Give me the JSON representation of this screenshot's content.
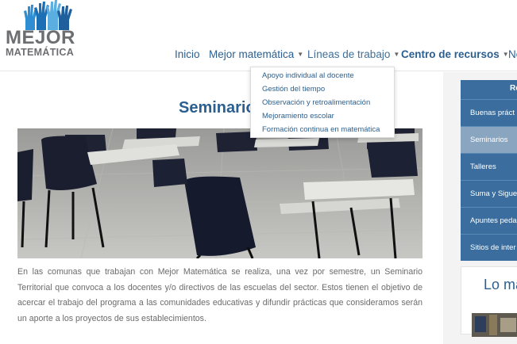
{
  "logo": {
    "word1": "MEJOR",
    "word2": "MATEMÁTICA",
    "icon": "raised-hands-logo",
    "colors": {
      "text": "#6d6e71",
      "hands": [
        "#1a6fb5",
        "#2f8ed1",
        "#5aaee0",
        "#1f5f9c"
      ]
    }
  },
  "nav": {
    "items": [
      {
        "label": "Inicio",
        "caret": ""
      },
      {
        "label": "Mejor matemática",
        "caret": "▼"
      },
      {
        "label": "Líneas de trabajo",
        "caret": "▼"
      },
      {
        "label": "Centro de recursos",
        "caret": "▼"
      },
      {
        "label": "No",
        "caret": ""
      }
    ],
    "color": "#2b5f8f"
  },
  "dropdown": {
    "items": [
      "Apoyo individual al docente",
      "Gestión del tiempo",
      "Observación y retroalimentación",
      "Mejoramiento escolar",
      "Formación continua en matemática"
    ]
  },
  "main": {
    "title": "Seminario",
    "image": "classroom-chairs-photo",
    "paragraph": "En las comunas que trabajan con Mejor Matemática se realiza, una vez por semestre, un Seminario Territorial que convoca a los docentes y/o directivos de las escuelas del sector. Estos tienen el objetivo de acercar el trabajo del programa a las comunidades educativas y difundir prácticas que consideramos serán un aporte a los proyectos de sus establecimientos."
  },
  "sidebar": {
    "header": "Re",
    "items": [
      {
        "label": "Buenas práct",
        "active": false
      },
      {
        "label": "Seminarios",
        "active": true
      },
      {
        "label": "Talleres",
        "active": false
      },
      {
        "label": "Suma y Sigue",
        "active": false
      },
      {
        "label": "Apuntes peda",
        "active": false
      },
      {
        "label": "Sitios de inter",
        "active": false
      }
    ],
    "box_title": "Lo má",
    "colors": {
      "item": "#3b6e9e",
      "active": "#8aa5bf"
    }
  }
}
